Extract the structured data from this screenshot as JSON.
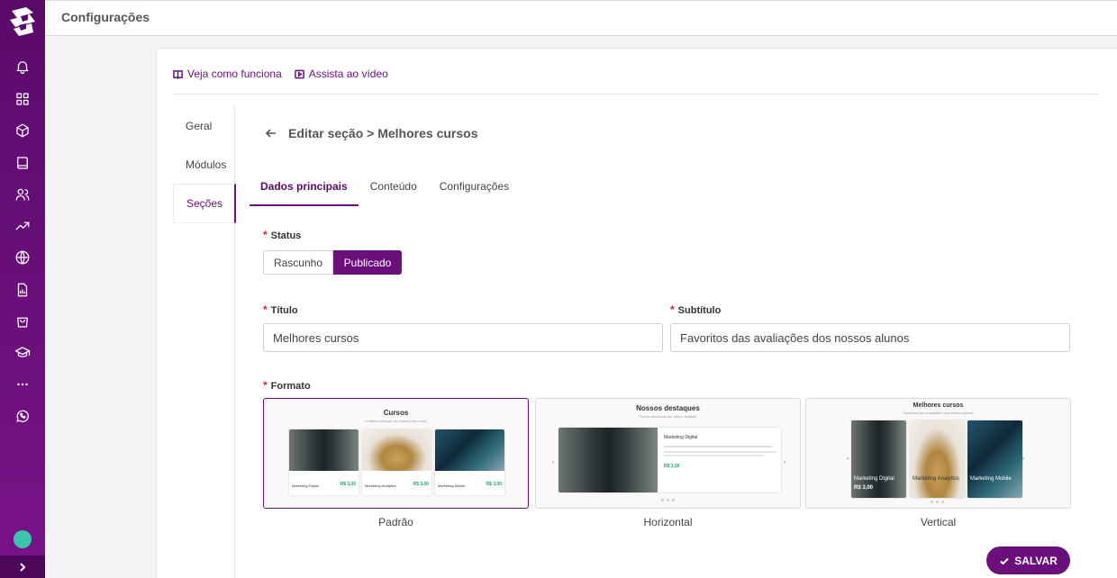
{
  "header": {
    "title": "Configurações"
  },
  "sidebar": {
    "icons": [
      "logo-icon",
      "bell-icon",
      "grid-icon",
      "box-icon",
      "book-icon",
      "users-icon",
      "trending-up-icon",
      "globe-icon",
      "file-chart-icon",
      "shopping-bag-icon",
      "graduation-cap-icon",
      "more-icon",
      "whatsapp-icon"
    ]
  },
  "help": {
    "how_it_works": "Veja como funciona",
    "watch_video": "Assista ao vídeo"
  },
  "left_tabs": [
    "Geral",
    "Módulos",
    "Seções"
  ],
  "section": {
    "title": "Editar seção > Melhores cursos"
  },
  "tabs": [
    "Dados principais",
    "Conteúdo",
    "Configurações"
  ],
  "form": {
    "status_label": "Status",
    "status_options": [
      "Rascunho",
      "Publicado"
    ],
    "status_selected": "Publicado",
    "title_label": "Título",
    "title_value": "Melhores cursos",
    "subtitle_label": "Subtítulo",
    "subtitle_value": "Favoritos das avaliações dos nossos alunos",
    "format_label": "Formato",
    "format_selected": "Padrão"
  },
  "formats": [
    {
      "caption": "Padrão",
      "preview_title": "Cursos",
      "preview_subtitle": "A melhor seleção de cursos para você!",
      "items": [
        {
          "name": "Marketing Digital",
          "price": "R$ 3,00"
        },
        {
          "name": "Marketing Analytics",
          "price": "R$ 3,00"
        },
        {
          "name": "Marketing Mobile",
          "price": "R$ 3,00"
        }
      ]
    },
    {
      "caption": "Horizontal",
      "preview_title": "Nossos destaques",
      "preview_subtitle": "Preços especiais por tempo limitado",
      "item": {
        "name": "Marketing Digital",
        "price": "R$ 3,00"
      }
    },
    {
      "caption": "Vertical",
      "preview_title": "Melhores cursos",
      "preview_subtitle": "Favoritos das avaliações dos nossos alunos",
      "items": [
        {
          "name": "Marketing Digital",
          "price": "R$ 3,00"
        },
        {
          "name": "Marketing Analytics",
          "price": ""
        },
        {
          "name": "Marketing Mobile",
          "price": ""
        }
      ]
    }
  ],
  "actions": {
    "save": "SALVAR"
  },
  "colors": {
    "brand": "#6b0f7c",
    "required": "#e0202c",
    "price": "#1aa37a"
  }
}
